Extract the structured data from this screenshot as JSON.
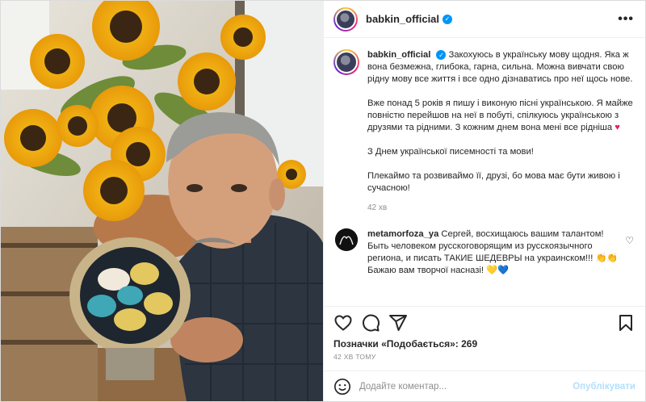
{
  "header": {
    "username": "babkin_official",
    "verified": true,
    "more_label": "•••"
  },
  "caption": {
    "username": "babkin_official",
    "paragraphs": [
      "Закохуюсь в українську мову щодня. Яка ж вона безмежна, глибока, гарна, сильна. Можна вивчати свою рідну мову все життя і все одно дізнаватись про неї щось нове.",
      "Вже понад 5 років я пишу і виконую пісні українською. Я майже повністю перейшов на неї в побуті, спілкуюсь українською з друзями та рідними. З кожним днем вона мені все рідніша",
      "З Днем української писемності та мови!",
      "Плекаймо та розвиваймо її, друзі, бо мова має бути живою і сучасною!"
    ],
    "heart_emoji": "♥",
    "time": "42 хв"
  },
  "comment": {
    "username": "metamorfoza_ya",
    "text": "Сергей, восхищаюсь вашим талантом! Быть человеком русскоговорящим из русскоязычного региона, и писать ТАКИЕ ШЕДЕВРЫ на украинском!!!",
    "text2": "Бажаю вам творчої насназі!",
    "clap_emoji": "👏👏",
    "hearts_emoji": "💛💙"
  },
  "likes": "Позначки «Подобається»: 269",
  "posted_ago": "42 ХВ ТОМУ",
  "add_comment": {
    "placeholder": "Додайте коментар...",
    "post_label": "Опублікувати"
  },
  "colors": {
    "accent": "#0095f6",
    "post_disabled": "#b2dffc",
    "heart": "#e0245e"
  },
  "icons": [
    "heart-icon",
    "comment-icon",
    "share-icon",
    "bookmark-icon",
    "emoji-icon",
    "verified-icon",
    "more-icon"
  ]
}
